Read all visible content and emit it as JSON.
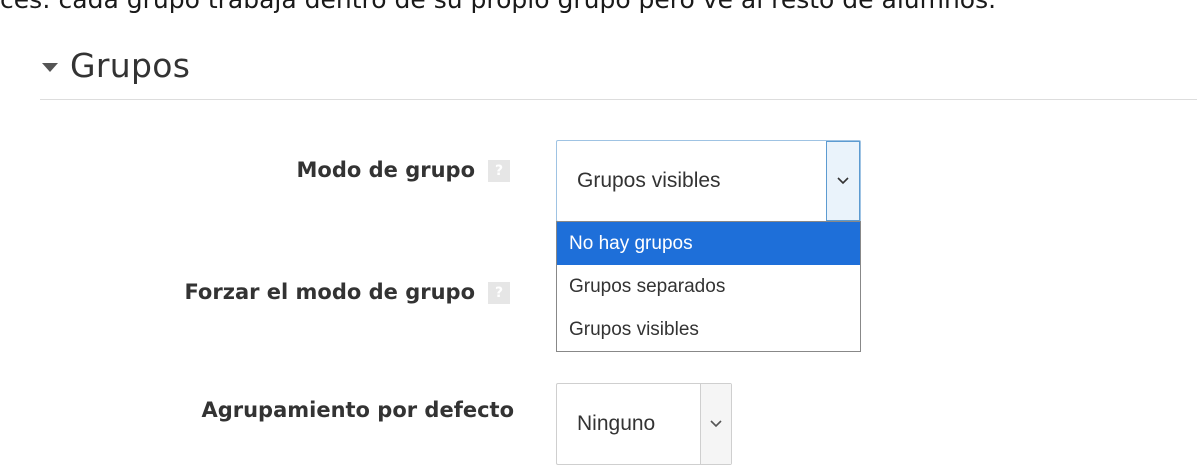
{
  "top_text": "ces: cada grupo trabaja dentro de su propio grupo pero ve al resto de alumnos.",
  "section": {
    "title": "Grupos",
    "icon": "caret-down-icon"
  },
  "fields": {
    "group_mode": {
      "label": "Modo de grupo",
      "help_icon": "?",
      "value": "Grupos visibles",
      "options": [
        "No hay grupos",
        "Grupos separados",
        "Grupos visibles"
      ],
      "highlighted_option": "No hay grupos"
    },
    "force_group_mode": {
      "label": "Forzar el modo de grupo",
      "help_icon": "?"
    },
    "default_grouping": {
      "label": "Agrupamiento por defecto",
      "value": "Ninguno"
    }
  },
  "colors": {
    "highlight": "#1e6fd9",
    "focus_border": "#5c9bd1",
    "help_icon_bg": "#e6e6e6",
    "rule": "#dddddd"
  }
}
